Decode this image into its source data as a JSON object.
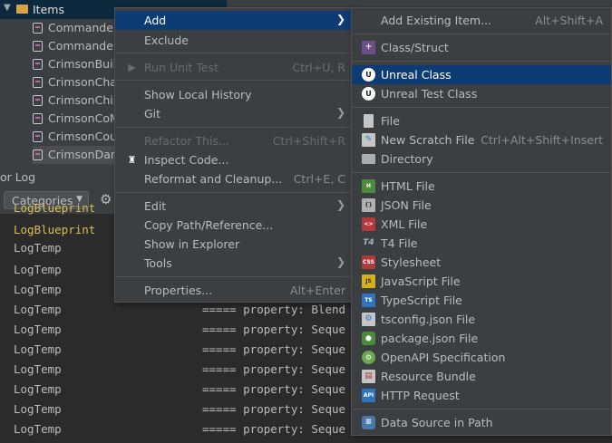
{
  "tree": {
    "root_label": "Items",
    "items": [
      {
        "label": "Commander"
      },
      {
        "label": "Commander"
      },
      {
        "label": "CrimsonBuild"
      },
      {
        "label": "CrimsonChar"
      },
      {
        "label": "CrimsonChip"
      },
      {
        "label": "CrimsonCoM"
      },
      {
        "label": "CrimsonCou"
      },
      {
        "label": "CrimsonDam"
      }
    ]
  },
  "log_panel": {
    "tab_label": "or Log",
    "categories_label": "Categories",
    "lines": [
      {
        "category": "LogBlueprint",
        "message": ""
      },
      {
        "category": "LogBlueprint",
        "message": ""
      },
      {
        "category": "LogTemp",
        "message": ""
      },
      {
        "category": "LogTemp",
        "message": ""
      },
      {
        "category": "LogTemp",
        "message": ""
      },
      {
        "category": "LogTemp",
        "message": "===== property: Blend"
      },
      {
        "category": "LogTemp",
        "message": "===== property: Seque"
      },
      {
        "category": "LogTemp",
        "message": "===== property: Seque"
      },
      {
        "category": "LogTemp",
        "message": "===== property: Seque"
      },
      {
        "category": "LogTemp",
        "message": "===== property: Seque"
      },
      {
        "category": "LogTemp",
        "message": "===== property: Seque"
      },
      {
        "category": "LogTemp",
        "message": "===== property: Seque"
      }
    ]
  },
  "context_menu": {
    "items": [
      {
        "label": "Add",
        "shortcut": "",
        "submenu": true,
        "highlighted": true
      },
      {
        "label": "Exclude",
        "shortcut": ""
      },
      {
        "label": "Run Unit Test",
        "shortcut": "Ctrl+U, R",
        "disabled": true,
        "icon": "run-icon"
      },
      {
        "label": "Show Local History",
        "shortcut": ""
      },
      {
        "label": "Git",
        "shortcut": "",
        "submenu": true
      },
      {
        "label": "Refactor This...",
        "shortcut": "Ctrl+Shift+R",
        "disabled": true
      },
      {
        "label": "Inspect Code...",
        "shortcut": "",
        "icon": "inspect-icon"
      },
      {
        "label": "Reformat and Cleanup...",
        "shortcut": "Ctrl+E, C"
      },
      {
        "label": "Edit",
        "shortcut": "",
        "submenu": true
      },
      {
        "label": "Copy Path/Reference...",
        "shortcut": ""
      },
      {
        "label": "Show in Explorer",
        "shortcut": ""
      },
      {
        "label": "Tools",
        "shortcut": "",
        "submenu": true
      },
      {
        "label": "Properties...",
        "shortcut": "Alt+Enter"
      }
    ]
  },
  "add_submenu": {
    "items": [
      {
        "label": "Add Existing Item...",
        "shortcut": "Alt+Shift+A"
      },
      {
        "label": "Class/Struct",
        "shortcut": "",
        "icon": "class-struct-icon"
      },
      {
        "label": "Unreal Class",
        "shortcut": "",
        "icon": "unreal-icon",
        "highlighted": true
      },
      {
        "label": "Unreal Test Class",
        "shortcut": "",
        "icon": "unreal-icon"
      },
      {
        "label": "File",
        "shortcut": "",
        "icon": "file-icon"
      },
      {
        "label": "New Scratch File",
        "shortcut": "Ctrl+Alt+Shift+Insert",
        "icon": "scratch-file-icon"
      },
      {
        "label": "Directory",
        "shortcut": "",
        "icon": "folder-icon"
      },
      {
        "label": "HTML File",
        "shortcut": "",
        "icon": "html-file-icon"
      },
      {
        "label": "JSON File",
        "shortcut": "",
        "icon": "json-file-icon"
      },
      {
        "label": "XML File",
        "shortcut": "",
        "icon": "xml-file-icon"
      },
      {
        "label": "T4 File",
        "shortcut": "",
        "icon": "t4-file-icon"
      },
      {
        "label": "Stylesheet",
        "shortcut": "",
        "icon": "css-file-icon"
      },
      {
        "label": "JavaScript File",
        "shortcut": "",
        "icon": "js-file-icon"
      },
      {
        "label": "TypeScript File",
        "shortcut": "",
        "icon": "ts-file-icon"
      },
      {
        "label": "tsconfig.json File",
        "shortcut": "",
        "icon": "tsconfig-icon"
      },
      {
        "label": "package.json File",
        "shortcut": "",
        "icon": "nodejs-icon"
      },
      {
        "label": "OpenAPI Specification",
        "shortcut": "",
        "icon": "openapi-icon"
      },
      {
        "label": "Resource Bundle",
        "shortcut": "",
        "icon": "resource-bundle-icon"
      },
      {
        "label": "HTTP Request",
        "shortcut": "",
        "icon": "api-icon"
      },
      {
        "label": "Data Source in Path",
        "shortcut": "",
        "icon": "database-icon"
      }
    ]
  },
  "colors": {
    "highlight": "#0d3b73",
    "menu_bg": "#3c3f41",
    "log_yellow": "#d6bf55"
  }
}
